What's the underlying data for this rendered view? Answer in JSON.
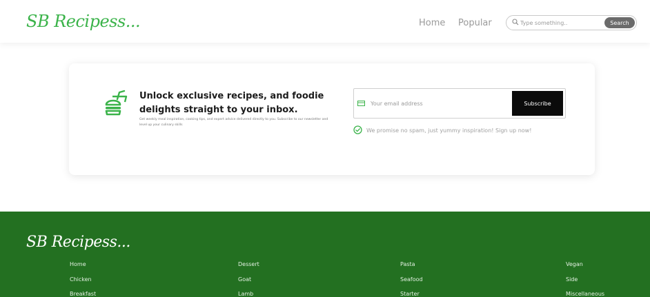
{
  "header": {
    "logo": "SB Recipess...",
    "nav": {
      "home": "Home",
      "popular": "Popular"
    },
    "search": {
      "placeholder": "Type something..",
      "button": "Search"
    }
  },
  "newsletter": {
    "title_line1": "Unlock exclusive recipes, and foodie",
    "title_line2": "delights straight to your inbox.",
    "description": "Get weekly meal inspiration, cooking tips, and expert advice delivered directly to you. Subscribe to our newsletter and level up your culinary skills",
    "email_placeholder": "Your email address",
    "subscribe_label": "Subscribe",
    "promise": "We promise no spam, just yummy inspiration! Sign up now!"
  },
  "footer": {
    "logo": "SB Recipess...",
    "columns": [
      [
        "Home",
        "Chicken",
        "Breakfast"
      ],
      [
        "Dessert",
        "Goat",
        "Lamb"
      ],
      [
        "Pasta",
        "Seafood",
        "Starter"
      ],
      [
        "Vegan",
        "Side",
        "Miscellaneous"
      ]
    ]
  },
  "colors": {
    "brand_green": "#3bb34a",
    "footer_green": "#237021",
    "subscribe_black": "#0b0b0b"
  },
  "icons": [
    "search-icon",
    "burger-icon",
    "mail-icon",
    "check-circle-icon"
  ]
}
